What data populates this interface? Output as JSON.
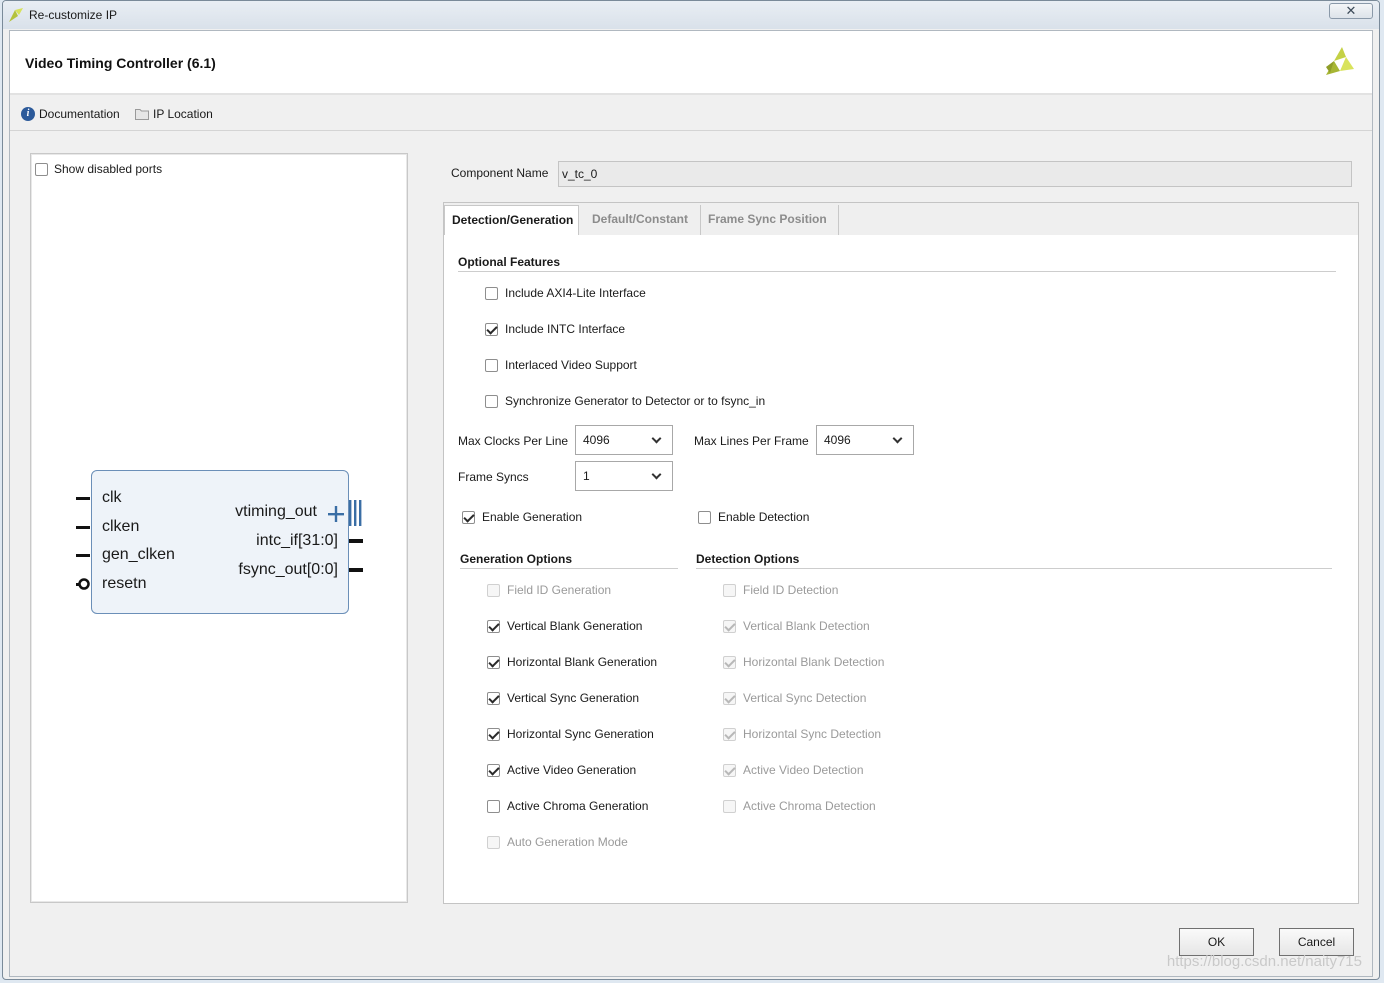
{
  "window": {
    "title": "Re-customize IP",
    "close_glyph": "✕"
  },
  "header": {
    "ip_title": "Video Timing Controller (6.1)"
  },
  "toolbar": {
    "documentation_label": "Documentation",
    "ip_location_label": "IP Location"
  },
  "left_panel": {
    "show_disabled_ports_label": "Show disabled ports",
    "show_disabled_ports_checked": false,
    "block": {
      "inputs": [
        "clk",
        "clken",
        "gen_clken",
        "resetn"
      ],
      "outputs": [
        "vtiming_out",
        "intc_if[31:0]",
        "fsync_out[0:0]"
      ]
    }
  },
  "component": {
    "label": "Component Name",
    "value": "v_tc_0"
  },
  "tabs": [
    {
      "label": "Detection/Generation",
      "active": true
    },
    {
      "label": "Default/Constant",
      "active": false
    },
    {
      "label": "Frame Sync Position",
      "active": false
    }
  ],
  "optional_features": {
    "title": "Optional Features",
    "items": [
      {
        "label": "Include AXI4-Lite Interface",
        "checked": false
      },
      {
        "label": "Include INTC Interface",
        "checked": true
      },
      {
        "label": "Interlaced Video Support",
        "checked": false
      },
      {
        "label": "Synchronize Generator to Detector or to fsync_in",
        "checked": false
      }
    ]
  },
  "params": {
    "max_clocks_label": "Max Clocks Per Line",
    "max_clocks_value": "4096",
    "max_lines_label": "Max Lines Per Frame",
    "max_lines_value": "4096",
    "frame_syncs_label": "Frame Syncs",
    "frame_syncs_value": "1"
  },
  "enable": {
    "generation_label": "Enable Generation",
    "generation_checked": true,
    "detection_label": "Enable Detection",
    "detection_checked": false
  },
  "generation_options": {
    "title": "Generation Options",
    "items": [
      {
        "label": "Field ID Generation",
        "checked": false,
        "disabled": true
      },
      {
        "label": "Vertical Blank Generation",
        "checked": true,
        "disabled": false
      },
      {
        "label": "Horizontal Blank Generation",
        "checked": true,
        "disabled": false
      },
      {
        "label": "Vertical Sync Generation",
        "checked": true,
        "disabled": false
      },
      {
        "label": "Horizontal Sync Generation",
        "checked": true,
        "disabled": false
      },
      {
        "label": "Active Video Generation",
        "checked": true,
        "disabled": false
      },
      {
        "label": "Active Chroma Generation",
        "checked": false,
        "disabled": false
      },
      {
        "label": "Auto Generation Mode",
        "checked": false,
        "disabled": true
      }
    ]
  },
  "detection_options": {
    "title": "Detection Options",
    "items": [
      {
        "label": "Field ID Detection",
        "checked": false,
        "disabled": true
      },
      {
        "label": "Vertical Blank Detection",
        "checked": true,
        "disabled": true
      },
      {
        "label": "Horizontal Blank Detection",
        "checked": true,
        "disabled": true
      },
      {
        "label": "Vertical Sync Detection",
        "checked": true,
        "disabled": true
      },
      {
        "label": "Horizontal Sync Detection",
        "checked": true,
        "disabled": true
      },
      {
        "label": "Active Video Detection",
        "checked": true,
        "disabled": true
      },
      {
        "label": "Active Chroma Detection",
        "checked": false,
        "disabled": true
      }
    ]
  },
  "footer": {
    "ok_label": "OK",
    "cancel_label": "Cancel"
  },
  "watermark": "https://blog.csdn.net/naity715",
  "colors": {
    "block_fill": "#eef3f9",
    "block_border": "#6b8fb8",
    "bus_pin": "#3a6ea5",
    "logo": "#b4c23c"
  },
  "icons": {
    "app": "vivado-logo-icon",
    "info": "info-icon",
    "folder": "folder-icon",
    "close": "close-icon",
    "dropdown": "chevron-down-icon"
  }
}
